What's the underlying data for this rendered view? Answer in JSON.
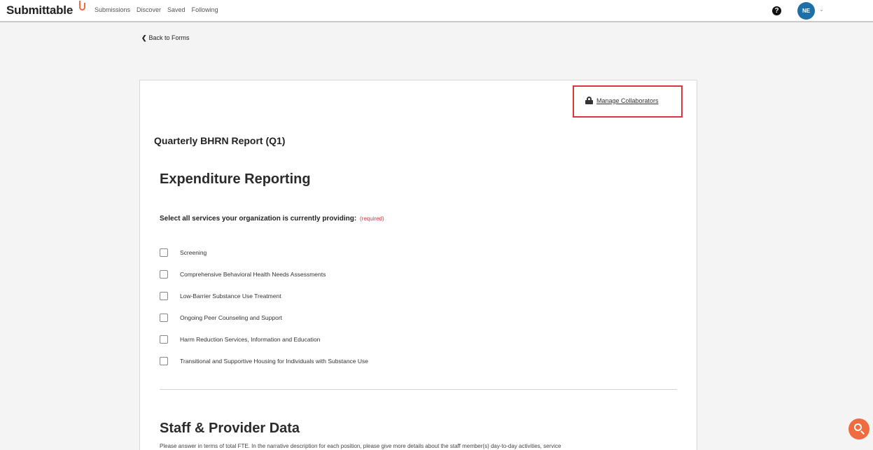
{
  "header": {
    "brand": "Submittable",
    "nav": [
      "Submissions",
      "Discover",
      "Saved",
      "Following"
    ],
    "avatar_initials": "NE"
  },
  "back_link": "Back to Forms",
  "collaborators_link": "Manage Collaborators",
  "form_title": "Quarterly BHRN Report (Q1)",
  "section1": {
    "heading": "Expenditure Reporting",
    "question": "Select all services your organization is currently providing:",
    "required_label": "(required)",
    "options": [
      "Screening",
      "Comprehensive Behavioral Health Needs Assessments",
      "Low-Barrier Substance Use Treatment",
      "Ongoing Peer Counseling and Support",
      "Harm Reduction Services, Information and Education",
      "Transitional and Supportive Housing for Individuals with Substance Use"
    ]
  },
  "section2": {
    "heading": "Staff & Provider Data",
    "description": "Please answer in terms of total FTE. In the narrative description for each position, please give more details about the staff member(s) day-to-day activities, service"
  },
  "colors": {
    "accent": "#f26b3a",
    "avatar_bg": "#1d6fa8",
    "highlight_box": "#d9363e",
    "required": "#d9363e"
  }
}
